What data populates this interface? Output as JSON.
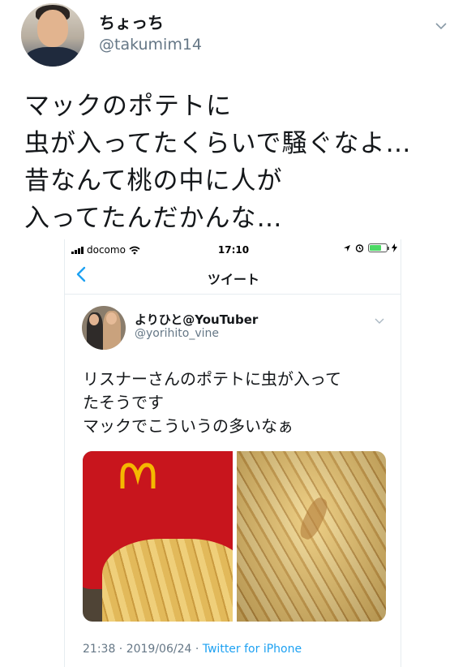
{
  "tweet": {
    "display_name": "ちょっち",
    "handle": "@takumim14",
    "text_lines": [
      "マックのポテトに",
      "虫が入ってたくらいで騒ぐなよ…",
      "昔なんて桃の中に人が",
      "入ってたんだかんな…"
    ]
  },
  "status_bar": {
    "carrier": "docomo",
    "time": "17:10",
    "battery_level": 0.7
  },
  "nav": {
    "back_icon": "chevron-left-icon",
    "title": "ツイート"
  },
  "quoted_tweet": {
    "display_name": "よりひと@YouTuber",
    "handle": "@yorihito_vine",
    "text_lines": [
      "リスナーさんのポテトに虫が入って",
      "たそうです",
      "マックでこういうの多いなぁ"
    ],
    "timestamp": "21:38 · 2019/06/24 · ",
    "source": "Twitter for iPhone"
  },
  "colors": {
    "link": "#1da1f2",
    "secondary_text": "#657786",
    "mcdonalds_red": "#c8151d",
    "mcdonalds_yellow": "#f5b800"
  }
}
